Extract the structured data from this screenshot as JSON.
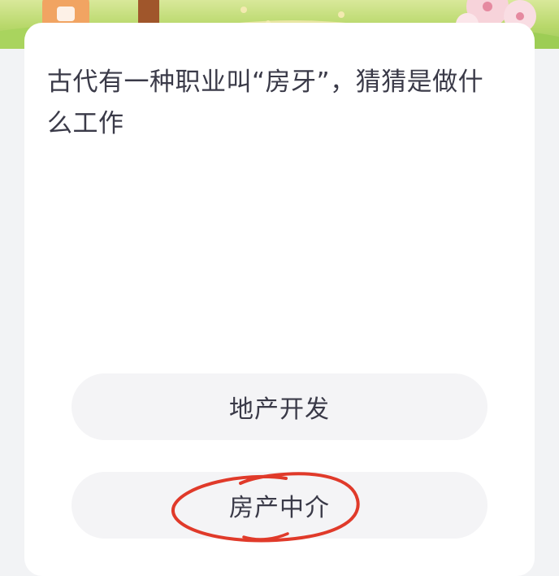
{
  "question": {
    "text": "古代有一种职业叫“房牙”，猜猜是做什么工作"
  },
  "options": [
    {
      "label": "地产开发"
    },
    {
      "label": "房产中介"
    }
  ],
  "annotation": {
    "type": "hand-drawn-circle",
    "color": "#e03a2a",
    "target": "options.1"
  },
  "colors": {
    "page_bg": "#f2f3f5",
    "card_bg": "#ffffff",
    "option_bg": "#f4f4f6",
    "text": "#3a3a48",
    "banner_green": "#b8d86a"
  }
}
